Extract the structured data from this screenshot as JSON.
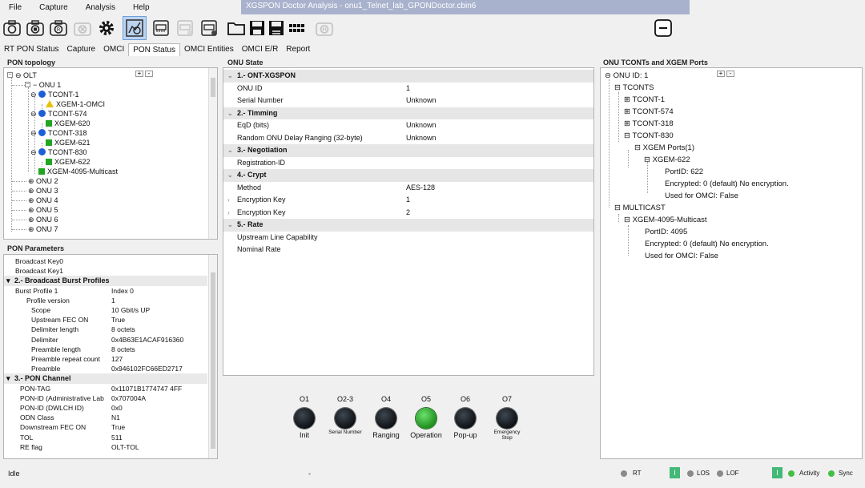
{
  "menu": [
    "File",
    "Capture",
    "Analysis",
    "Help"
  ],
  "window_title": "XGSPON Doctor Analysis - onu1_Telnet_lab_GPONDoctor.cbin6",
  "toolbar_icons": [
    "camera-icon",
    "camera-save-icon",
    "camera-refresh-icon",
    "stop-icon",
    "gear-icon",
    "pon-stats-icon",
    "network-card-icon",
    "network-card-disabled-icon",
    "network-card-settings-icon",
    "folder-open-icon",
    "save-icon",
    "save-as-icon",
    "keypad-icon",
    "pause-icon",
    "minimize-icon"
  ],
  "tabs": [
    "RT PON Status",
    "Capture",
    "OMCI",
    "PON Status",
    "OMCI Entities",
    "OMCI E/R",
    "Report"
  ],
  "active_tab": "PON Status",
  "pon_topology": {
    "title": "PON topology",
    "expand_btn": "+",
    "collapse_btn": "-",
    "nodes": [
      "OLT",
      "ONU 1",
      "TCONT-1",
      "XGEM-1-OMCI",
      "TCONT-574",
      "XGEM-620",
      "TCONT-318",
      "XGEM-621",
      "TCONT-830",
      "XGEM-622",
      "XGEM-4095-Multicast",
      "ONU 2",
      "ONU 3",
      "ONU 4",
      "ONU 5",
      "ONU 6",
      "ONU 7"
    ]
  },
  "pon_parameters": {
    "title": "PON Parameters",
    "rows": [
      {
        "k": "Broadcast Key0",
        "v": ""
      },
      {
        "k": "Broadcast Key1",
        "v": ""
      },
      {
        "k": "2.- Broadcast Burst Profiles",
        "v": "",
        "cat": true
      },
      {
        "k": "Burst Profile 1",
        "v": "Index 0"
      },
      {
        "k": "Profile version",
        "v": "1"
      },
      {
        "k": "Scope",
        "v": "10 Gbit/s UP"
      },
      {
        "k": "Upstream FEC ON",
        "v": "True"
      },
      {
        "k": "Delimiter length",
        "v": "8 octets"
      },
      {
        "k": "Delimiter",
        "v": "0x4B63E1ACAF916360"
      },
      {
        "k": "Preamble length",
        "v": "8 octets"
      },
      {
        "k": "Preamble repeat count",
        "v": "127"
      },
      {
        "k": "Preamble",
        "v": "0x946102FC66ED2717"
      },
      {
        "k": "3.- PON Channel",
        "v": "",
        "cat": true
      },
      {
        "k": "PON-TAG",
        "v": "0x11071B1774747 4FF"
      },
      {
        "k": "PON-ID (Administrative Lab",
        "v": "0x707004A"
      },
      {
        "k": "PON-ID (DWLCH ID)",
        "v": "0x0"
      },
      {
        "k": "ODN Class",
        "v": "N1"
      },
      {
        "k": "Downstream FEC ON",
        "v": "True"
      },
      {
        "k": "TOL",
        "v": "511"
      },
      {
        "k": "RE flag",
        "v": "OLT-TOL"
      }
    ]
  },
  "onu_state": {
    "title": "ONU State",
    "rows": [
      {
        "k": "1.- ONT-XGSPON",
        "v": "",
        "cat": true
      },
      {
        "k": "ONU ID",
        "v": "1"
      },
      {
        "k": "Serial Number",
        "v": "Unknown"
      },
      {
        "k": "2.- Timming",
        "v": "",
        "cat": true
      },
      {
        "k": "EqD (bits)",
        "v": "Unknown"
      },
      {
        "k": "Random ONU Delay Ranging (32-byte)",
        "v": "Unknown"
      },
      {
        "k": "3.- Negotiation",
        "v": "",
        "cat": true
      },
      {
        "k": "Registration-ID",
        "v": ""
      },
      {
        "k": "4.- Crypt",
        "v": "",
        "cat": true
      },
      {
        "k": "Method",
        "v": "AES-128"
      },
      {
        "k": "Encryption Key",
        "v": "1",
        "caret": true
      },
      {
        "k": "Encryption Key",
        "v": "2",
        "caret": true
      },
      {
        "k": "5.- Rate",
        "v": "",
        "cat": true
      },
      {
        "k": "Upstream Line Capability",
        "v": ""
      },
      {
        "k": "Nominal Rate",
        "v": ""
      }
    ]
  },
  "state_leds": [
    {
      "code": "O1",
      "label": "Init",
      "on": false
    },
    {
      "code": "O2-3",
      "label": "Serial Number",
      "on": false
    },
    {
      "code": "O4",
      "label": "Ranging",
      "on": false
    },
    {
      "code": "O5",
      "label": "Operation",
      "on": true
    },
    {
      "code": "O6",
      "label": "Pop-up",
      "on": false
    },
    {
      "code": "O7",
      "label": "Emergency Stop",
      "on": false
    }
  ],
  "tconts_panel": {
    "title": "ONU TCONTs and XGEM Ports",
    "root": "ONU ID: 1",
    "tconts_label": "TCONTS",
    "tconts": [
      "TCONT-1",
      "TCONT-574",
      "TCONT-318",
      "TCONT-830"
    ],
    "xgem_ports_label": "XGEM Ports(1)",
    "xgem": "XGEM-622",
    "xgem_details": [
      "PortID: 622",
      "Encrypted: 0 (default) No encryption.",
      "Used for OMCI: False"
    ],
    "multicast_label": "MULTICAST",
    "multicast_xgem": "XGEM-4095-Multicast",
    "multicast_details": [
      "PortID: 4095",
      "Encrypted: 0 (default) No encryption.",
      "Used for OMCI: False"
    ]
  },
  "statusbar": {
    "status": "Idle",
    "center": "-",
    "rt_label": "RT",
    "los_label": "LOS",
    "lof_label": "LOF",
    "activity_label": "Activity",
    "sync_label": "Sync",
    "indicator_letter": "I"
  },
  "colors": {
    "titlebar": "#a8b2cd",
    "led_on": "#2fa02f",
    "status_green": "#43b877",
    "tree_blue": "#1f5fd6",
    "tree_green": "#22a622"
  }
}
